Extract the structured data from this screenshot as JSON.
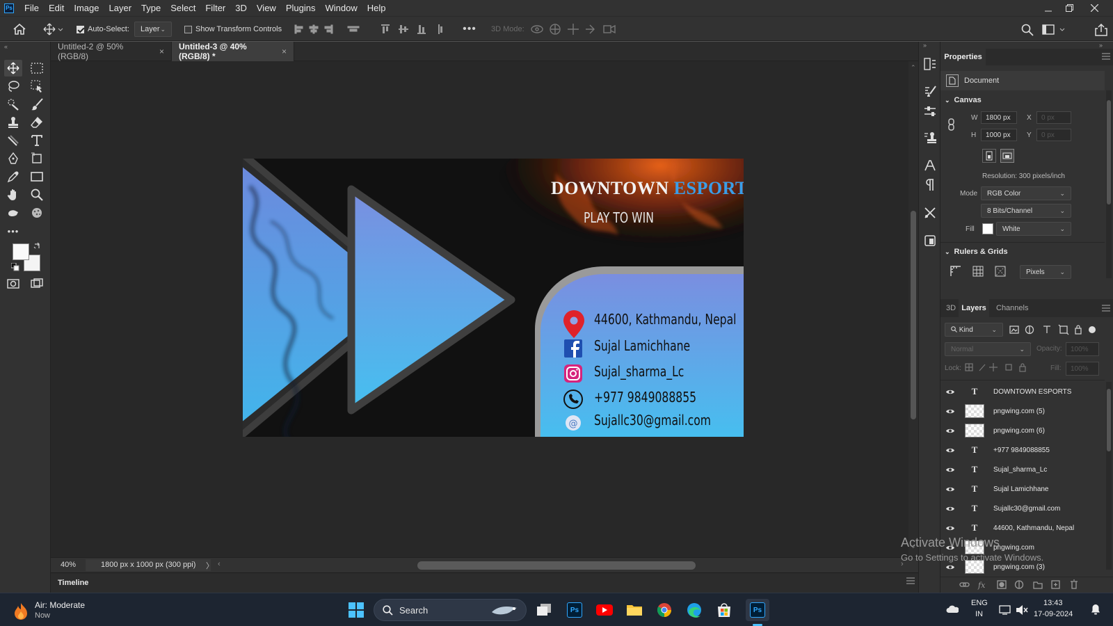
{
  "app": {
    "logo": "Ps",
    "menu": [
      "File",
      "Edit",
      "Image",
      "Layer",
      "Type",
      "Select",
      "Filter",
      "3D",
      "View",
      "Plugins",
      "Window",
      "Help"
    ]
  },
  "options": {
    "auto_select_label": "Auto-Select:",
    "auto_select_target": "Layer",
    "transform_controls_label": "Show Transform Controls",
    "mode_3d_label": "3D Mode:"
  },
  "tabs": [
    {
      "label": "Untitled-2 @ 50% (RGB/8)",
      "close": "×"
    },
    {
      "label": "Untitled-3 @ 40% (RGB/8) *",
      "close": "×"
    }
  ],
  "card": {
    "title_white": "DOWNTOWN",
    "title_blue": "ESPORTS",
    "tagline": "PLAY TO WIN",
    "address": "44600, Kathmandu, Nepal",
    "facebook": "Sujal Lamichhane",
    "instagram": "Sujal_sharma_Lc",
    "phone": "+977 9849088855",
    "email": "Sujallc30@gmail.com"
  },
  "status": {
    "zoom": "40%",
    "doc_info": "1800 px x 1000 px (300 ppi)",
    "timeline_label": "Timeline"
  },
  "properties": {
    "tab": "Properties",
    "doc_label": "Document",
    "canvas_header": "Canvas",
    "w_label": "W",
    "w_value": "1800 px",
    "h_label": "H",
    "h_value": "1000 px",
    "x_label": "X",
    "x_value": "0 px",
    "y_label": "Y",
    "y_value": "0 px",
    "resolution": "Resolution: 300 pixels/inch",
    "mode_label": "Mode",
    "mode_value": "RGB Color",
    "bits_value": "8 Bits/Channel",
    "fill_label": "Fill",
    "fill_value": "White",
    "rulers_header": "Rulers & Grids",
    "units_value": "Pixels"
  },
  "layers_panel": {
    "tabs": [
      "3D",
      "Layers",
      "Channels"
    ],
    "kind_label": "Kind",
    "blend_mode": "Normal",
    "opacity_label": "Opacity:",
    "opacity_value": "100%",
    "lock_label": "Lock:",
    "fill_label": "Fill:",
    "fill_value": "100%",
    "layers": [
      {
        "name": "DOWNTOWN ESPORTS",
        "type": "text"
      },
      {
        "name": "pngwing.com (5)",
        "type": "image"
      },
      {
        "name": "pngwing.com (6)",
        "type": "image"
      },
      {
        "name": "+977 9849088855",
        "type": "text"
      },
      {
        "name": "Sujal_sharma_Lc",
        "type": "text"
      },
      {
        "name": "Sujal Lamichhane",
        "type": "text"
      },
      {
        "name": "Sujallc30@gmail.com",
        "type": "text"
      },
      {
        "name": "44600, Kathmandu, Nepal",
        "type": "text"
      },
      {
        "name": "pngwing.com",
        "type": "image"
      },
      {
        "name": "pngwing.com (3)",
        "type": "image"
      }
    ]
  },
  "watermark": {
    "line1": "Activate Windows",
    "line2": "Go to Settings to activate Windows."
  },
  "taskbar": {
    "weather_title": "Air: Moderate",
    "weather_sub": "Now",
    "search_label": "Search",
    "lang": "ENG",
    "region": "IN",
    "time": "13:43",
    "date": "17-09-2024"
  },
  "colors": {
    "accent": "#31a8ff",
    "card_blue_top": "#7a8ee0",
    "card_blue_bottom": "#45c0f0",
    "title_blue": "#3a9ee8",
    "pin_red": "#e0222a"
  }
}
